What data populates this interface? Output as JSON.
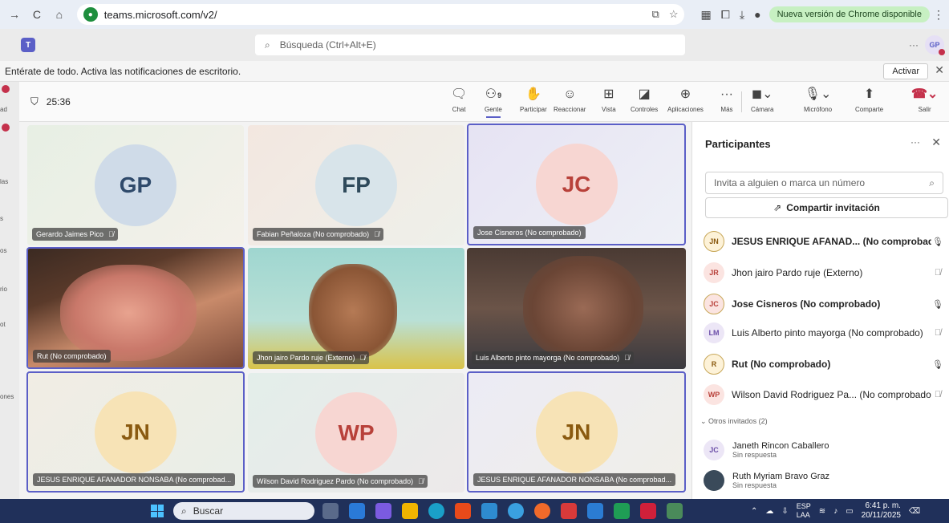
{
  "browser": {
    "url": "teams.microsoft.com/v2/",
    "update_label": "Nueva versión de Chrome disponible"
  },
  "teams": {
    "search_placeholder": "Búsqueda (Ctrl+Alt+E)",
    "avatar_initials": "GP"
  },
  "notification": {
    "text": "Entérate de todo. Activa las notificaciones de escritorio.",
    "button": "Activar"
  },
  "left_rail": [
    "ad",
    "las",
    "s",
    "os",
    "rio",
    "ot",
    "ones"
  ],
  "meeting": {
    "timer": "25:36",
    "people_count": "9",
    "toolbar": {
      "chat": "Chat",
      "people": "Gente",
      "raise": "Participar",
      "react": "Reaccionar",
      "view": "Vista",
      "controls": "Controles",
      "apps": "Aplicaciones",
      "more": "Más",
      "camera": "Cámara",
      "mic": "Micrófono",
      "share": "Comparte",
      "leave": "Salir"
    }
  },
  "tiles": [
    {
      "initials": "GP",
      "name": "Gerardo Jaimes Pico",
      "color": "#cfdbe8",
      "text": "#2f4a6b"
    },
    {
      "initials": "FP",
      "name": "Fabian Peñaloza (No comprobado)",
      "color": "#d8e4ea",
      "text": "#2f4a5b"
    },
    {
      "initials": "JC",
      "name": "Jose Cisneros (No comprobado)",
      "color": "#f7d6d2",
      "text": "#b8413a"
    },
    {
      "name": "Rut (No comprobado)"
    },
    {
      "name": "Jhon jairo Pardo ruje (Externo)"
    },
    {
      "name": "Luis Alberto pinto mayorga (No comprobado)"
    },
    {
      "initials": "JN",
      "name": "JESUS ENRIQUE AFANADOR NONSABA (No comprobad...",
      "color": "#f7e3b6",
      "text": "#8a5a10"
    },
    {
      "initials": "WP",
      "name": "Wilson David Rodriguez Pardo (No comprobado)",
      "color": "#f7d6d2",
      "text": "#b8413a"
    },
    {
      "initials": "JN",
      "name": "JESUS ENRIQUE AFANADOR NONSABA (No comprobad...",
      "color": "#f7e3b6",
      "text": "#8a5a10"
    }
  ],
  "panel": {
    "title": "Participantes",
    "invite_placeholder": "Invita a alguien o marca un número",
    "share_label": "Compartir invitación",
    "participants": [
      {
        "initials": "JN",
        "name": "JESUS ENRIQUE AFANAD... (No comprobado)",
        "bg": "#fdf2d8",
        "fg": "#8a5a10",
        "bold": true,
        "muted": false
      },
      {
        "initials": "JR",
        "name": "Jhon jairo Pardo ruje (Externo)",
        "bg": "#fbe4e1",
        "fg": "#b8413a",
        "bold": false,
        "muted": true
      },
      {
        "initials": "JC",
        "name": "Jose Cisneros (No comprobado)",
        "bg": "#fbe4e1",
        "fg": "#b8413a",
        "bold": true,
        "muted": false
      },
      {
        "initials": "LM",
        "name": "Luis Alberto pinto mayorga (No comprobado)",
        "bg": "#ece6f6",
        "fg": "#6b4ea8",
        "bold": false,
        "muted": true
      },
      {
        "initials": "R",
        "name": "Rut (No comprobado)",
        "bg": "#fdf2d8",
        "fg": "#8a5a10",
        "bold": true,
        "muted": false
      },
      {
        "initials": "WP",
        "name": "Wilson David Rodriguez Pa... (No comprobado)",
        "bg": "#fbe4e1",
        "fg": "#b8413a",
        "bold": false,
        "muted": true
      }
    ],
    "others_header": "Otros invitados (2)",
    "guests": [
      {
        "initials": "JC",
        "name": "Janeth Rincon Caballero",
        "status": "Sin respuesta"
      },
      {
        "name": "Ruth Myriam Bravo Graz",
        "status": "Sin respuesta"
      }
    ]
  },
  "taskbar": {
    "search": "Buscar",
    "lang_top": "ESP",
    "lang_bottom": "LAA",
    "time": "6:41 p. m.",
    "date": "20/11/2025"
  }
}
